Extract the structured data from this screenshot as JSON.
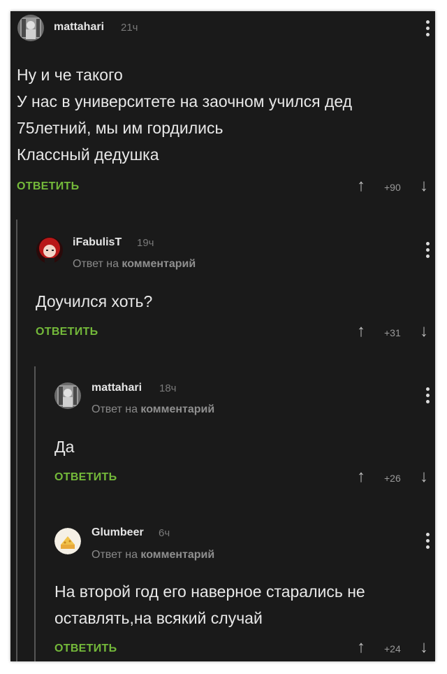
{
  "comments": [
    {
      "username": "mattahari",
      "time": "21ч",
      "reply_to": "",
      "lines": [
        "Ну и че такого",
        "У нас в университете на заочном учился дед",
        "75летний, мы им гордились",
        "Классный дедушка"
      ],
      "reply_label": "ОТВЕТИТЬ",
      "votes": "+90"
    },
    {
      "username": "iFabulisT",
      "time": "19ч",
      "reply_to_prefix": "Ответ на",
      "reply_to_link": "комментарий",
      "lines": [
        "Доучился хоть?"
      ],
      "reply_label": "ОТВЕТИТЬ",
      "votes": "+31"
    },
    {
      "username": "mattahari",
      "time": "18ч",
      "reply_to_prefix": "Ответ на",
      "reply_to_link": "комментарий",
      "lines": [
        "Да"
      ],
      "reply_label": "ОТВЕТИТЬ",
      "votes": "+26"
    },
    {
      "username": "Glumbeer",
      "time": "6ч",
      "reply_to_prefix": "Ответ на",
      "reply_to_link": "комментарий",
      "lines": [
        "На второй год его наверное старались не",
        "оставлять,на всякий случай"
      ],
      "reply_label": "ОТВЕТИТЬ",
      "votes": "+24"
    }
  ],
  "icons": {
    "upvote": "↑",
    "downvote": "↓",
    "menu": "more-vertical-icon"
  },
  "colors": {
    "background": "#1a1a1a",
    "reply_button": "#74b93a",
    "text": "#e8e8e8"
  }
}
